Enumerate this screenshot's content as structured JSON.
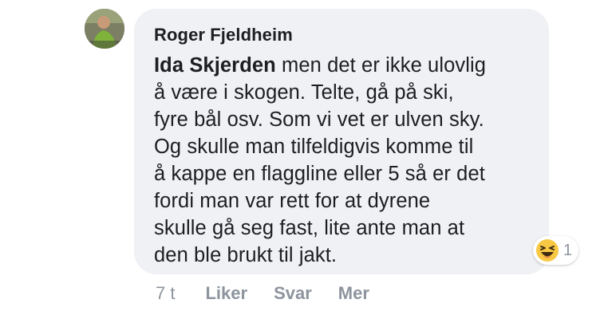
{
  "comment": {
    "author": "Roger Fjeldheim",
    "mention": "Ida Skjerden",
    "text_lines": [
      " men det er ikke ulovlig",
      "å være i skogen. Telte, gå på ski,",
      "fyre bål osv. Som vi vet er ulven sky.",
      "Og skulle man tilfeldigvis komme til",
      "å kappe en flaggline eller 5 så er det",
      "fordi man var rett for at dyrene",
      "skulle gå seg fast, lite ante man at",
      "den ble brukt til jakt."
    ],
    "reaction": {
      "icon": "haha-emoji-icon",
      "count": "1"
    }
  },
  "actions": {
    "timestamp": "7 t",
    "like_label": "Liker",
    "reply_label": "Svar",
    "more_label": "Mer"
  },
  "colors": {
    "bubble_bg": "#eff1f4",
    "text": "#1c1e21",
    "muted": "#8d949e",
    "reaction_yellow": "#f7c843"
  }
}
